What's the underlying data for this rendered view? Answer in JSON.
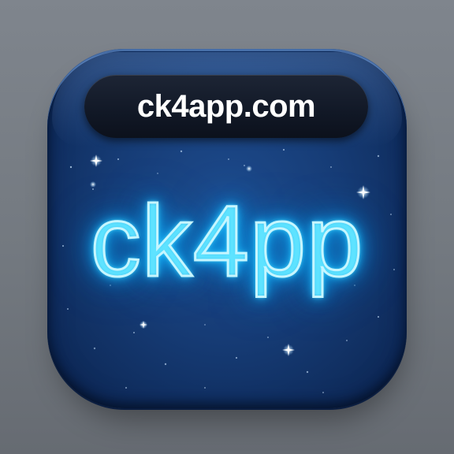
{
  "badge": {
    "label": "ck4app.com"
  },
  "neon_title": {
    "text": "ck4pp"
  },
  "colors": {
    "background": "#7a8088",
    "icon_base": "#163c76",
    "pill": "#111826",
    "neon": "#27c8ff",
    "neon_core": "#c6f6ff"
  },
  "icons": {
    "sparkles": "star-sparkle-icon"
  }
}
